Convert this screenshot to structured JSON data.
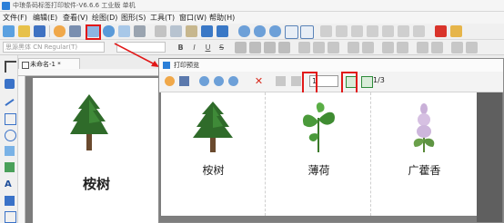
{
  "app": {
    "title": "中琅条码标签打印软件-V6.6.6 工业版 单机",
    "menu": [
      "文件(F)",
      "编辑(E)",
      "查看(V)",
      "绘图(D)",
      "图形(S)",
      "工具(T)",
      "窗口(W)",
      "帮助(H)"
    ]
  },
  "toolbar": {
    "font_name": "思源黑体 CN Regular(T)",
    "format_buttons": [
      "B",
      "I",
      "U",
      "S"
    ]
  },
  "document": {
    "tab_title": "未命名-1 *",
    "label_text": "桉树"
  },
  "preview": {
    "window_title": "打印预览",
    "page_input_value": "1",
    "page_count": "1/3",
    "labels": [
      "桉树",
      "薄荷",
      "广藿香"
    ]
  },
  "colors": {
    "highlight": "#e11818",
    "accent": "#2b7fd8",
    "canvas_bg": "#7c7c7c"
  }
}
